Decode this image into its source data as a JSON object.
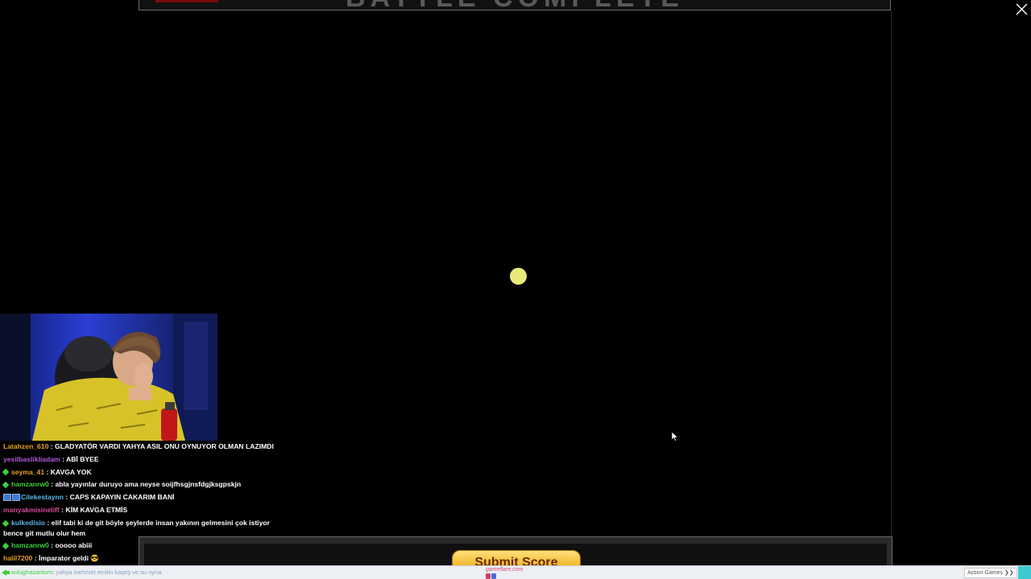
{
  "game": {
    "title": "BATTLE COMPLETE",
    "submit_label": "Submit Score"
  },
  "overlay": {
    "close_icon": "close-icon",
    "loading_indicator_color": "#eaea7a"
  },
  "chat": {
    "messages": [
      {
        "user": "Latahzen_610",
        "color": "#e8a020",
        "badge": "none",
        "text": " : GLADYATÖR VARDI YAHYA ASIL ONU OYNUYOR OLMAN LAZIMDI"
      },
      {
        "user": "yesilbaslikliadam",
        "color": "#b05ad8",
        "badge": "none",
        "text": " : ABİ BYEE"
      },
      {
        "user": "seyma_41",
        "color": "#e8a020",
        "badge": "diamond",
        "text": " : KAVGA YOK"
      },
      {
        "user": "hamzanrw0",
        "color": "#3fcf3f",
        "badge": "diamond",
        "text": " : abla yayınlar duruyo ama neyse soijfhsgjnsfdgjksgpskjn"
      },
      {
        "user": "Cilekestaynn",
        "color": "#5ab8e8",
        "badge": "box",
        "text": " : CAPS KAPAYIN CAKARIM BANİ"
      },
      {
        "user": "manyakmisineliff",
        "color": "#d84a9a",
        "badge": "none",
        "text": " : KİM KAVGA ETMİS"
      },
      {
        "user": "kulkedisio",
        "color": "#5ab8e8",
        "badge": "diamond",
        "text": " : elif tabi ki de git böyle şeylerde insan yakının gelmesini çok istiyor bence git mutlu olur hem"
      },
      {
        "user": "hamzanrw0",
        "color": "#3fcf3f",
        "badge": "diamond",
        "text": " : ooooo abiii"
      },
      {
        "user": "halil7200",
        "color": "#e8a020",
        "badge": "none",
        "text": " : İmparator geldi 😎"
      }
    ]
  },
  "bottom_bar": {
    "ticker_user": "xulughazanturn",
    "ticker_text": ": yahya mehmet emilin kaşeş ve su oyna",
    "logo_text": "gameflare.com",
    "action_games_label": "Action Games ❯❯"
  },
  "colors": {
    "background": "#000000",
    "frame_border": "#6a6a6a",
    "submit_gold": "#f0b020",
    "bottom_bar": "#eceff3",
    "accent_teal": "#3ccad0"
  }
}
